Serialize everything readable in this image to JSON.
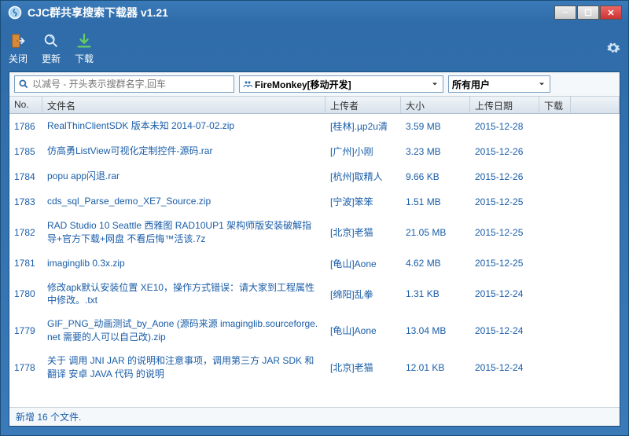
{
  "window": {
    "title": "CJC群共享搜索下载器 v1.21"
  },
  "toolbar": {
    "close": "关闭",
    "update": "更新",
    "download": "下载"
  },
  "filters": {
    "search_placeholder": "以减号 - 开头表示搜群名字,回车",
    "group_selected": "FireMonkey[移动开发]",
    "user_selected": "所有用户"
  },
  "columns": {
    "no": "No.",
    "name": "文件名",
    "uploader": "上传者",
    "size": "大小",
    "date": "上传日期",
    "download": "下载"
  },
  "rows": [
    {
      "no": "1786",
      "name": "RealThinClientSDK 版本未知 2014-07-02.zip",
      "uploader": "[桂林].µp2u清",
      "size": "3.59 MB",
      "date": "2015-12-28"
    },
    {
      "no": "1785",
      "name": "仿高勇ListView可视化定制控件-源码.rar",
      "uploader": "[广州]小刚",
      "size": "3.23 MB",
      "date": "2015-12-26"
    },
    {
      "no": "1784",
      "name": "popu app闪退.rar",
      "uploader": "[杭州]取精人",
      "size": "9.66 KB",
      "date": "2015-12-26"
    },
    {
      "no": "1783",
      "name": "cds_sql_Parse_demo_XE7_Source.zip",
      "uploader": "[宁波]笨笨",
      "size": "1.51 MB",
      "date": "2015-12-25"
    },
    {
      "no": "1782",
      "name": "RAD Studio 10 Seattle 西雅图 RAD10UP1 架构师版安装破解指导+官方下载+网盘 不看后悔™活该.7z",
      "uploader": "[北京]老猫",
      "size": "21.05 MB",
      "date": "2015-12-25"
    },
    {
      "no": "1781",
      "name": "imaginglib 0.3x.zip",
      "uploader": "[龟山]Aone",
      "size": "4.62 MB",
      "date": "2015-12-25"
    },
    {
      "no": "1780",
      "name": "修改apk默认安装位置 XE10，操作方式错误：请大家到工程属性中修改。.txt",
      "uploader": "[绵阳]乱拳",
      "size": "1.31 KB",
      "date": "2015-12-24"
    },
    {
      "no": "1779",
      "name": "GIF_PNG_动画测试_by_Aone (源码来源 imaginglib.sourceforge.net 需要的人可以自己改).zip",
      "uploader": "[龟山]Aone",
      "size": "13.04 MB",
      "date": "2015-12-24"
    },
    {
      "no": "1778",
      "name": "关于 调用 JNI JAR  的说明和注意事项，调用第三方 JAR SDK 和 翻译 安卓 JAVA 代码 的说明",
      "uploader": "[北京]老猫",
      "size": "12.01 KB",
      "date": "2015-12-24"
    }
  ],
  "status": "新增 16 个文件."
}
